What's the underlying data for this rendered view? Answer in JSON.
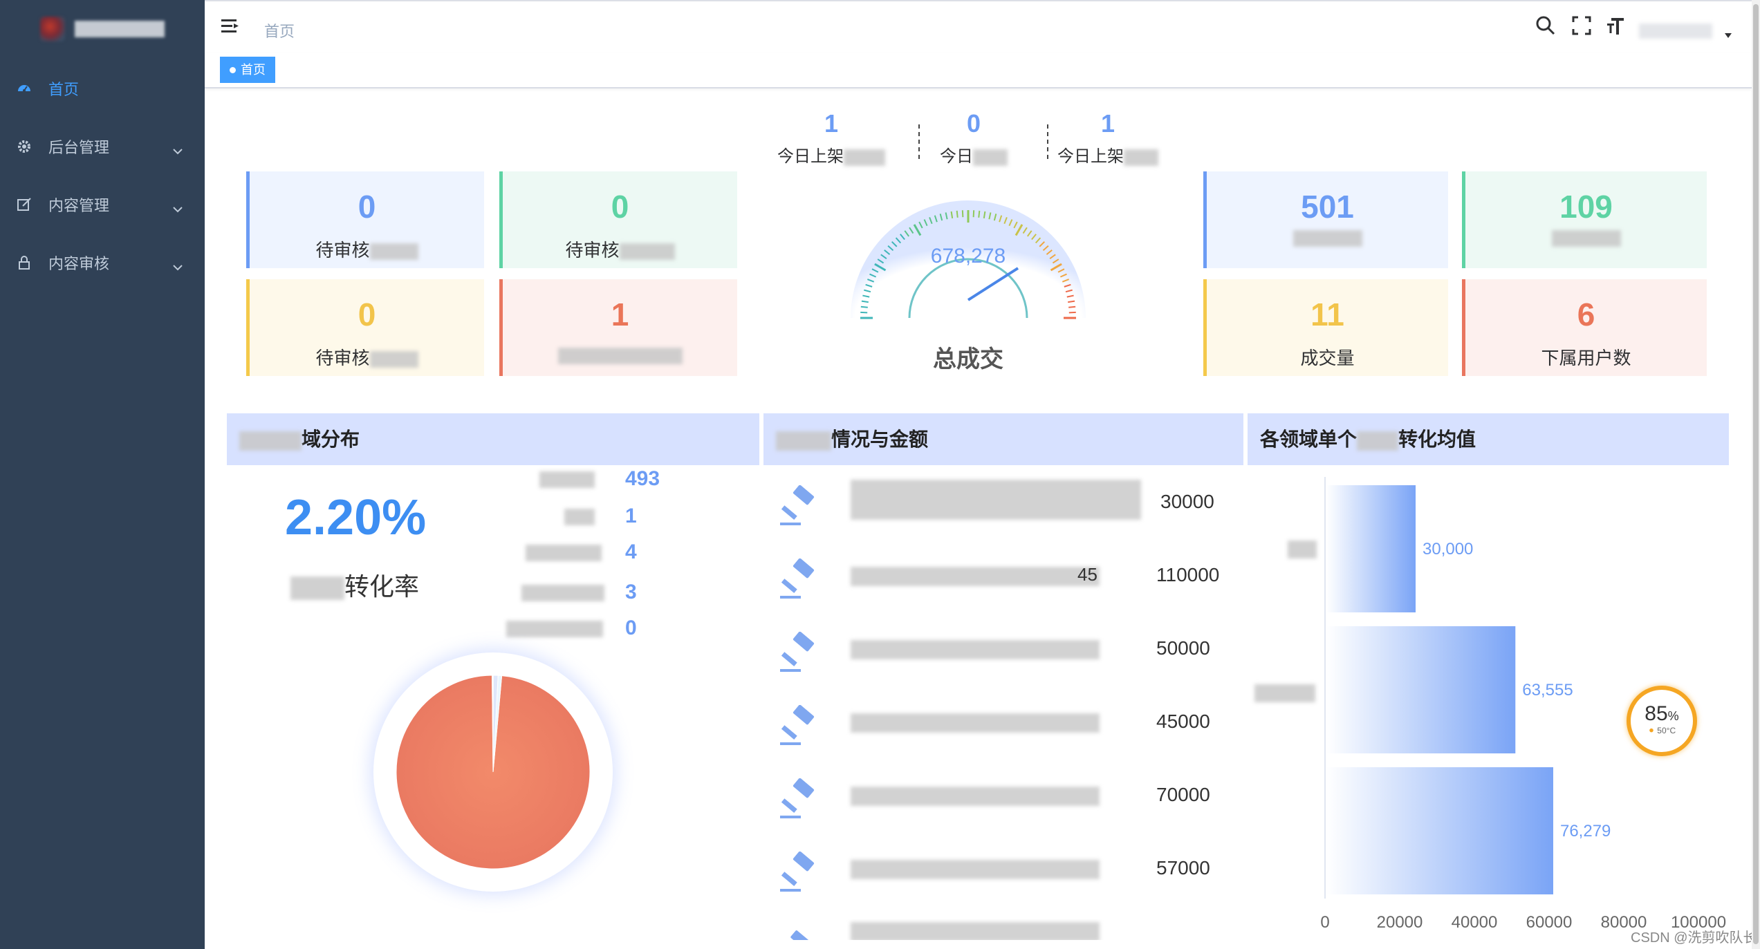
{
  "sidebar": {
    "items": [
      {
        "label": "首页",
        "icon": "dashboard-icon",
        "active": true
      },
      {
        "label": "后台管理",
        "icon": "gear-icon",
        "active": false
      },
      {
        "label": "内容管理",
        "icon": "edit-icon",
        "active": false
      },
      {
        "label": "内容审核",
        "icon": "lock-icon",
        "active": false
      }
    ]
  },
  "navbar": {
    "breadcrumb": "首页",
    "icons": [
      "search-icon",
      "fullscreen-icon",
      "font-size-icon"
    ]
  },
  "tags": {
    "active_tag": "首页"
  },
  "top_stats": [
    {
      "value": "1",
      "label": "今日上架"
    },
    {
      "value": "0",
      "label": "今日"
    },
    {
      "value": "1",
      "label": "今日上架"
    }
  ],
  "left_cards": [
    {
      "value": "0",
      "label": "待审核"
    },
    {
      "value": "0",
      "label": "待审核"
    },
    {
      "value": "0",
      "label": "待审核"
    },
    {
      "value": "1",
      "label": ""
    }
  ],
  "right_cards": [
    {
      "value": "501",
      "label": ""
    },
    {
      "value": "109",
      "label": ""
    },
    {
      "value": "11",
      "label": "成交量"
    },
    {
      "value": "6",
      "label": "下属用户数"
    }
  ],
  "gauge": {
    "value_text": "678,278",
    "label": "总成交"
  },
  "panel_distribution": {
    "title": "域分布",
    "rate": "2.20%",
    "rate_label": "转化率",
    "values": [
      "493",
      "1",
      "4",
      "3",
      "0"
    ]
  },
  "panel_auctions": {
    "title": "情况与金额",
    "amounts": [
      "30000",
      "110000",
      "50000",
      "45000",
      "70000",
      "57000"
    ],
    "partial_text": [
      "45"
    ]
  },
  "panel_conversion": {
    "title": "各领域单个",
    "title_suffix": "转化均值"
  },
  "chart_data": {
    "type": "bar",
    "orientation": "horizontal",
    "categories": [
      "",
      "",
      ""
    ],
    "values": [
      30000,
      63555,
      76279
    ],
    "value_labels": [
      "30,000",
      "63,555",
      "76,279"
    ],
    "xlim": [
      0,
      100000
    ],
    "x_ticks": [
      "0",
      "20000",
      "40000",
      "60000",
      "80000",
      "100000"
    ],
    "grid": false
  },
  "badge": {
    "percent": "85",
    "unit": "%",
    "temp": "50°C"
  },
  "watermark": "CSDN @洗剪吹队长",
  "colors": {
    "sidebar_bg": "#304156",
    "accent": "#409eff",
    "blue": "#6c9cf4",
    "green": "#5ed3a4",
    "yellow": "#f4c94a",
    "red": "#e9765f",
    "panel_head": "#d7e1ff"
  }
}
